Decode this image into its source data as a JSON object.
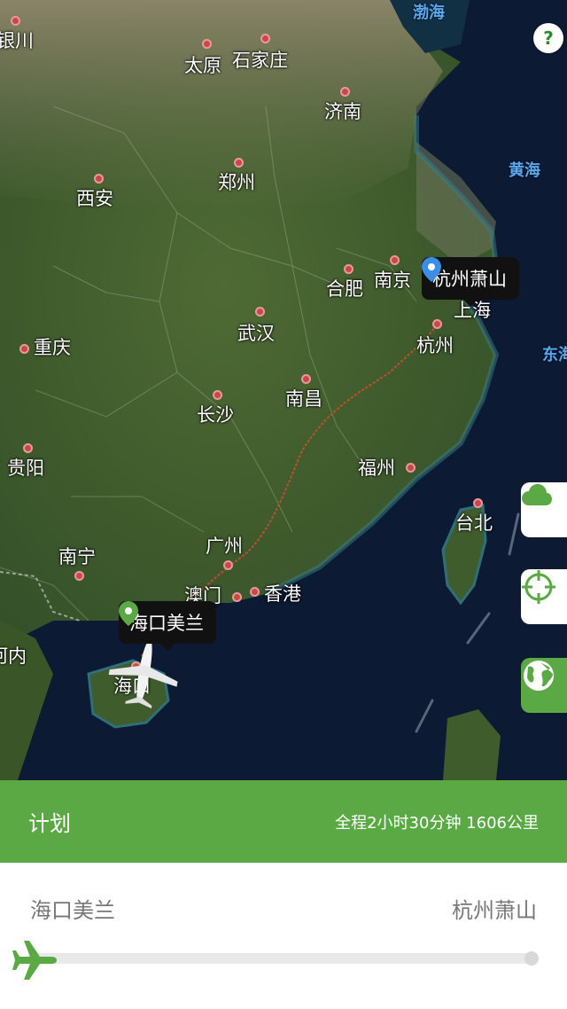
{
  "map": {
    "seas": [
      {
        "id": "bohai",
        "name": "渤海"
      },
      {
        "id": "huanghai",
        "name": "黄海"
      },
      {
        "id": "donghai",
        "name": "东海"
      }
    ],
    "cities": [
      {
        "id": "yinchuan",
        "name": "银川"
      },
      {
        "id": "taiyuan",
        "name": "太原"
      },
      {
        "id": "shijiazhuang",
        "name": "石家庄"
      },
      {
        "id": "jinan",
        "name": "济南"
      },
      {
        "id": "zhengzhou",
        "name": "郑州"
      },
      {
        "id": "xian",
        "name": "西安"
      },
      {
        "id": "hefei",
        "name": "合肥"
      },
      {
        "id": "nanjing",
        "name": "南京"
      },
      {
        "id": "shanghai",
        "name": "上海"
      },
      {
        "id": "wuhan",
        "name": "武汉"
      },
      {
        "id": "hangzhou",
        "name": "杭州"
      },
      {
        "id": "chongqing",
        "name": "重庆"
      },
      {
        "id": "nanchang",
        "name": "南昌"
      },
      {
        "id": "changsha",
        "name": "长沙"
      },
      {
        "id": "guiyang",
        "name": "贵阳"
      },
      {
        "id": "fuzhou",
        "name": "福州"
      },
      {
        "id": "taibei",
        "name": "台北"
      },
      {
        "id": "nanning",
        "name": "南宁"
      },
      {
        "id": "guangzhou",
        "name": "广州"
      },
      {
        "id": "aomen",
        "name": "澳门"
      },
      {
        "id": "xianggang",
        "name": "香港"
      },
      {
        "id": "haikou",
        "name": "海口"
      },
      {
        "id": "henei",
        "name": "河内"
      }
    ],
    "origin_pin": {
      "label": "海口美兰",
      "color": "#5aa944"
    },
    "destination_pin": {
      "label": "杭州萧山",
      "color": "#3a8ee6"
    },
    "help_label": "?",
    "side_buttons": [
      {
        "icon": "cloud-icon",
        "color": "#5aa944"
      },
      {
        "icon": "crosshair-icon",
        "color": "#5aa944"
      },
      {
        "icon": "globe-icon",
        "color": "#5aa944"
      }
    ]
  },
  "plan": {
    "title": "计划",
    "summary": "全程2小时30分钟 1606公里"
  },
  "route": {
    "from": "海口美兰",
    "to": "杭州萧山",
    "progress": 0.0
  },
  "colors": {
    "accent": "#5aa944",
    "route_line": "#c0502a",
    "destination": "#3a8ee6"
  }
}
